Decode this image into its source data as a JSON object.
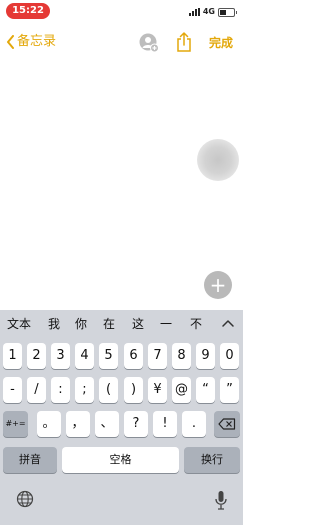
{
  "status_bar": {
    "time": "15:22",
    "network": "4G"
  },
  "nav": {
    "back_label": "备忘录",
    "done_label": "完成"
  },
  "keyboard": {
    "candidates": [
      "文本",
      "我",
      "你",
      "在",
      "这",
      "一",
      "不"
    ],
    "row_digits": [
      "1",
      "2",
      "3",
      "4",
      "5",
      "6",
      "7",
      "8",
      "9",
      "0"
    ],
    "row_symbols": [
      "-",
      "/",
      ":",
      ";",
      "(",
      ")",
      "¥",
      "@",
      "“",
      "”"
    ],
    "row_punct": {
      "shift": "#+=",
      "keys": [
        "。",
        "，",
        "、",
        "?",
        "!",
        "."
      ]
    },
    "bottom": {
      "pinyin": "拼音",
      "space": "空格",
      "return": "换行"
    }
  },
  "icons": [
    "back-chevron-icon",
    "add-collaborator-icon",
    "share-icon",
    "touch-circle",
    "plus-icon",
    "chevron-up-icon",
    "backspace-icon",
    "globe-icon",
    "microphone-icon"
  ],
  "colors": {
    "accent": "#e3a80b",
    "time_pill": "#e53935",
    "keyboard_bg": "#d2d5db"
  }
}
